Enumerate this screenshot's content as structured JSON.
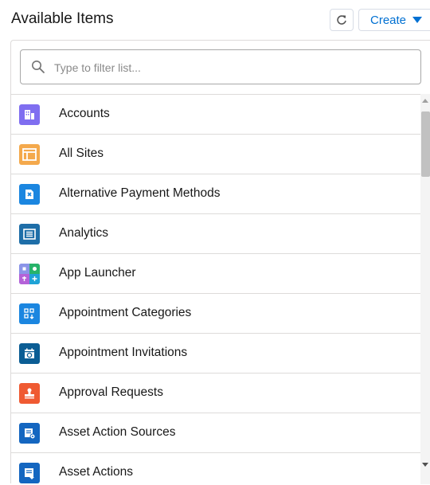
{
  "header": {
    "title": "Available Items",
    "create_label": "Create"
  },
  "search": {
    "placeholder": "Type to filter list..."
  },
  "items": [
    {
      "label": "Accounts",
      "icon": "accounts-icon",
      "color": "#7f6ef0"
    },
    {
      "label": "All Sites",
      "icon": "all-sites-icon",
      "color": "#f4a94c"
    },
    {
      "label": "Alternative Payment Methods",
      "icon": "payment-method-icon",
      "color": "#1b86e0"
    },
    {
      "label": "Analytics",
      "icon": "analytics-icon",
      "color": "#1e6ea8"
    },
    {
      "label": "App Launcher",
      "icon": "app-launcher-icon",
      "color": "#6a76d9"
    },
    {
      "label": "Appointment Categories",
      "icon": "appointment-categories-icon",
      "color": "#1b86e0"
    },
    {
      "label": "Appointment Invitations",
      "icon": "appointment-invitations-icon",
      "color": "#0b5d94"
    },
    {
      "label": "Approval Requests",
      "icon": "approval-requests-icon",
      "color": "#ef5a32"
    },
    {
      "label": "Asset Action Sources",
      "icon": "asset-action-sources-icon",
      "color": "#1466c0"
    },
    {
      "label": "Asset Actions",
      "icon": "asset-actions-icon",
      "color": "#1466c0"
    }
  ]
}
